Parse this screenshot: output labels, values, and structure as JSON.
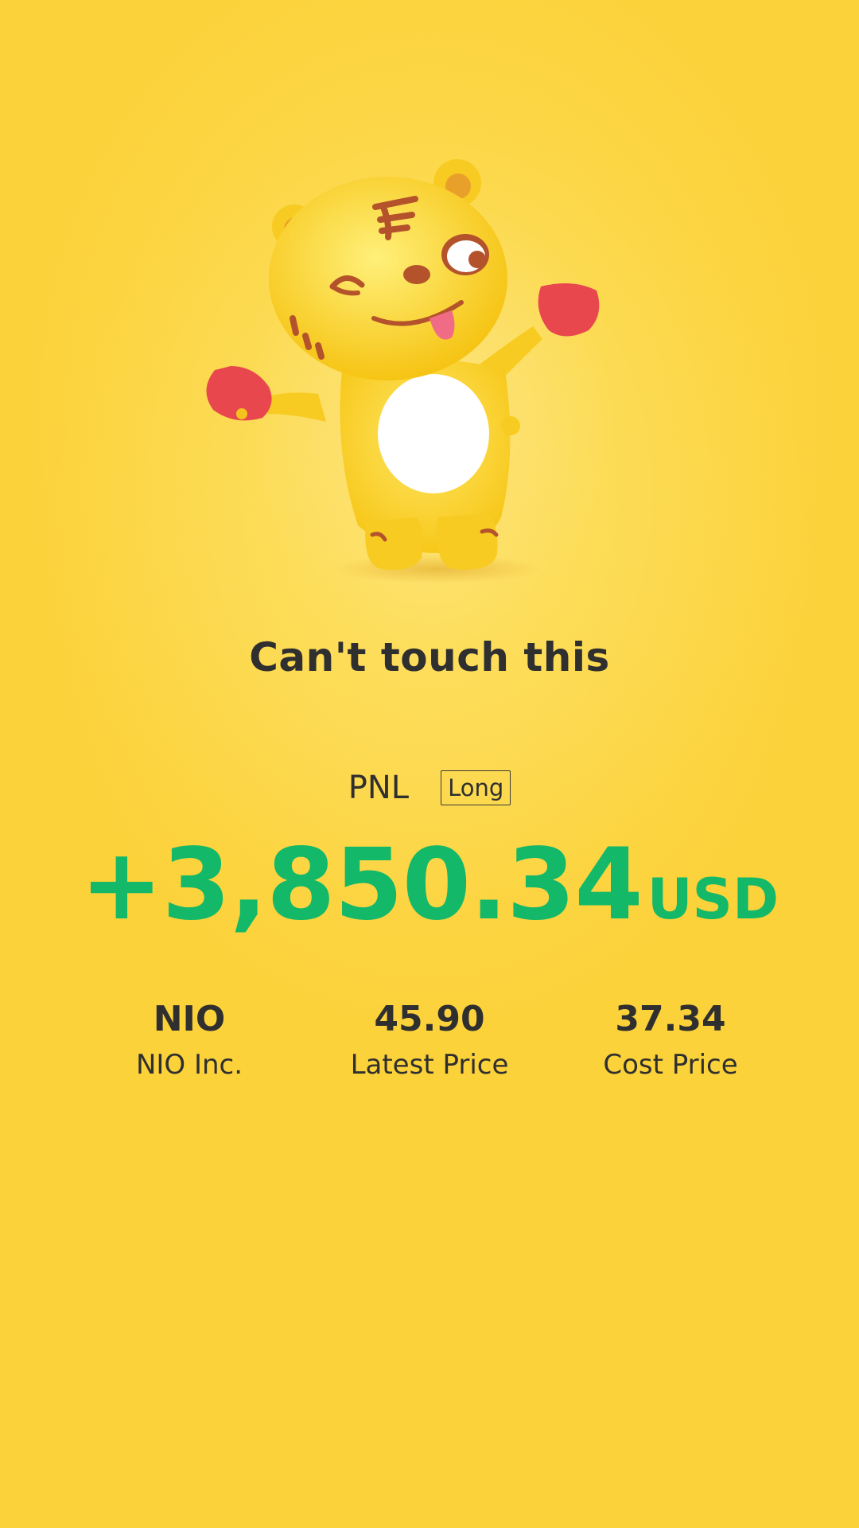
{
  "share_card": {
    "headline": "Can't touch this",
    "mascot_icon": "tiger-mascot-icon"
  },
  "pnl": {
    "label": "PNL",
    "position": "Long",
    "amount": "+3,850.34",
    "currency": "USD",
    "color": "#13b868"
  },
  "stats": {
    "symbol": {
      "value": "NIO",
      "label": "NIO Inc."
    },
    "latest_price": {
      "value": "45.90",
      "label": "Latest Price"
    },
    "cost_price": {
      "value": "37.34",
      "label": "Cost Price"
    }
  },
  "colors": {
    "background": "#fcd23a",
    "text": "#2f2f2f",
    "profit": "#13b868"
  }
}
